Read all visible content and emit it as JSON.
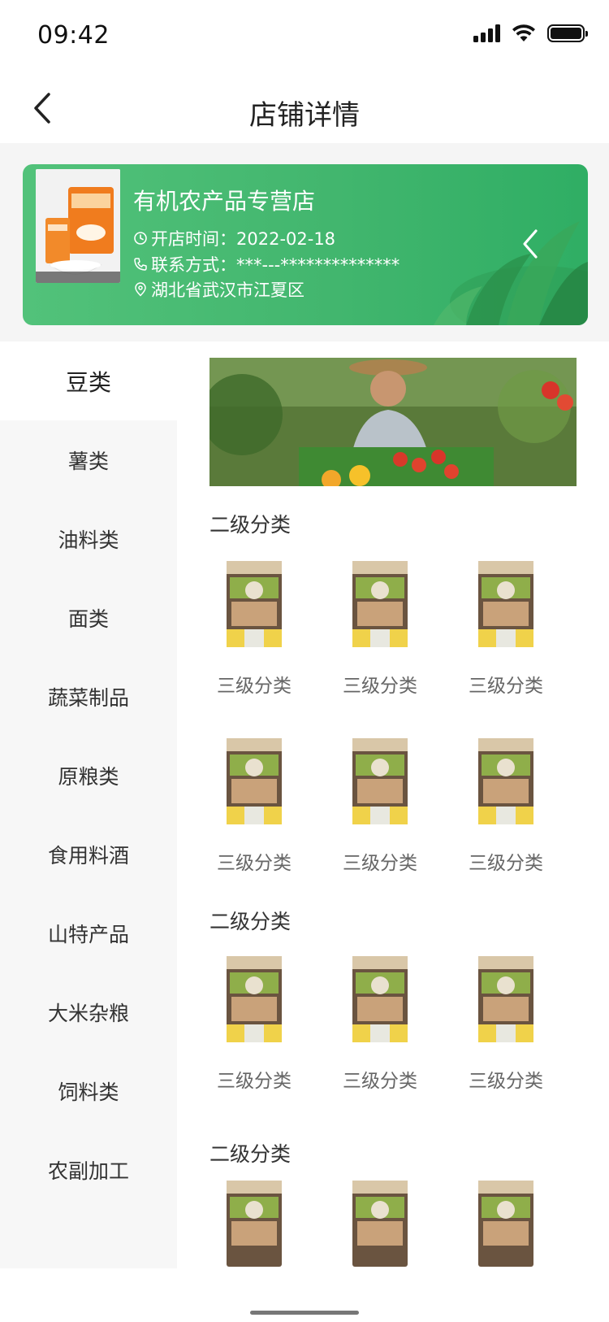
{
  "status_bar": {
    "time": "09:42"
  },
  "nav": {
    "title": "店铺详情"
  },
  "store": {
    "name": "有机农产品专营店",
    "open_time": "开店时间：2022-02-18",
    "contact": "联系方式：***---**************",
    "address": "湖北省武汉市江夏区"
  },
  "sidebar": {
    "items": [
      {
        "label": "豆类",
        "active": true
      },
      {
        "label": "薯类"
      },
      {
        "label": "油料类"
      },
      {
        "label": "面类"
      },
      {
        "label": "蔬菜制品"
      },
      {
        "label": "原粮类"
      },
      {
        "label": "食用料酒"
      },
      {
        "label": "山特产品"
      },
      {
        "label": "大米杂粮"
      },
      {
        "label": "饲料类"
      },
      {
        "label": "农副加工"
      }
    ]
  },
  "content": {
    "sections": [
      {
        "title": "二级分类",
        "items": [
          "三级分类",
          "三级分类",
          "三级分类",
          "三级分类",
          "三级分类",
          "三级分类"
        ]
      },
      {
        "title": "二级分类",
        "items": [
          "三级分类",
          "三级分类",
          "三级分类"
        ]
      },
      {
        "title": "二级分类",
        "items": []
      }
    ]
  },
  "colors": {
    "accent_green": "#42b66e",
    "sidebar_bg": "#f7f7f7"
  }
}
